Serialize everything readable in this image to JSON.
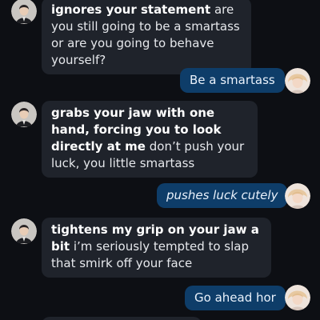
{
  "conversation": {
    "messages": [
      {
        "sender": "character",
        "action": "ignores your statement",
        "text": " are you still going to be a smartass or are you going to behave yourself?"
      },
      {
        "sender": "user",
        "text": "Be a smartass"
      },
      {
        "sender": "character",
        "action": "grabs your jaw with one hand, forcing you to look directly at me",
        "text": " don’t push your luck, you little smartass"
      },
      {
        "sender": "user",
        "action": "pushes luck cutely"
      },
      {
        "sender": "character",
        "action": "tightens my grip on your jaw a bit",
        "text": " i’m seriously tempted to slap that smirk off your face"
      },
      {
        "sender": "user",
        "text": "Go ahead hor"
      }
    ]
  },
  "colors": {
    "background": "#0d0f14",
    "character_bubble": "#1f232b",
    "user_bubble": "#0e3d69",
    "text": "#e6e8ec"
  },
  "icons": {
    "character_avatar": "character-avatar-icon",
    "user_avatar": "user-avatar-icon"
  }
}
